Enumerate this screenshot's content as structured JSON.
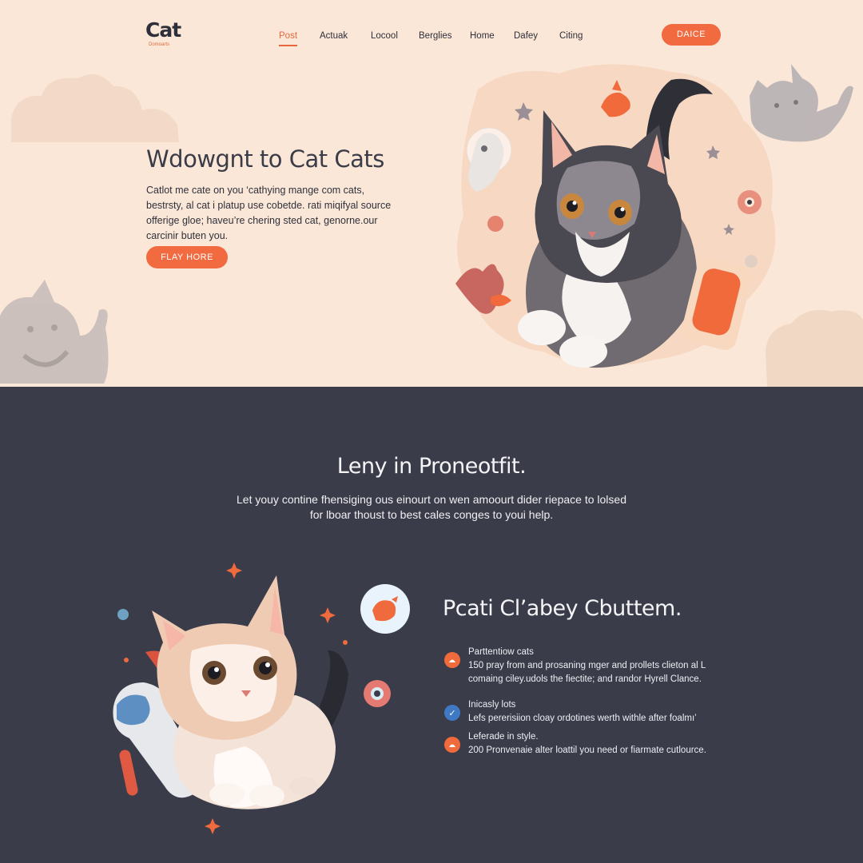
{
  "colors": {
    "accent": "#f26a3f",
    "hero_bg": "#fbe7d7",
    "dark_bg": "#3b3c4a",
    "check_blue": "#3f79c4"
  },
  "header": {
    "logo_text": "Cat",
    "logo_sub": "Domoarts",
    "nav": [
      "Post",
      "Actuak",
      "Locool",
      "Berglies",
      "Home",
      "Dafey",
      "Citing"
    ],
    "cta": "DAICE"
  },
  "hero": {
    "title": "Wdowgnt to Cat Cats",
    "body": [
      "Catlot me cate on you ‘cathying mange com cats,",
      "bestrsty, al cat i platup use cobetde. rati miqifyal source",
      "offerige gloe; haveu’re chering sted cat, genorne.our",
      "carcinir buten you."
    ],
    "button": "FLAY HORE"
  },
  "section": {
    "title": "Leny in Proneotfit.",
    "subtitle": [
      "Let youy contine fhensiging ous einourt on wen amoourt dider riepace to lolsed",
      "for lboar thoust to best cales conges to youi help."
    ]
  },
  "features": {
    "title": "Pcati Cl’abey Cbuttem.",
    "items": [
      {
        "icon": "circle-dot-icon",
        "heading": "Parttentiow cats",
        "lines": [
          "150 pray from and prosaning mger and prollets clieton al L",
          "comaing ciley.udols the fiectite; and randor Hyrell Clance."
        ]
      },
      {
        "icon": "check-icon",
        "heading": "Inicasly lots",
        "lines": [
          "Lefs pererisiion cloay ordotines werth withle after foalmı’"
        ]
      },
      {
        "icon": "circle-dot-icon",
        "heading": "Leferade in style.",
        "lines": [
          "200 Pronvenaie alter loattil you need or fiarmate cutlource."
        ]
      }
    ]
  }
}
